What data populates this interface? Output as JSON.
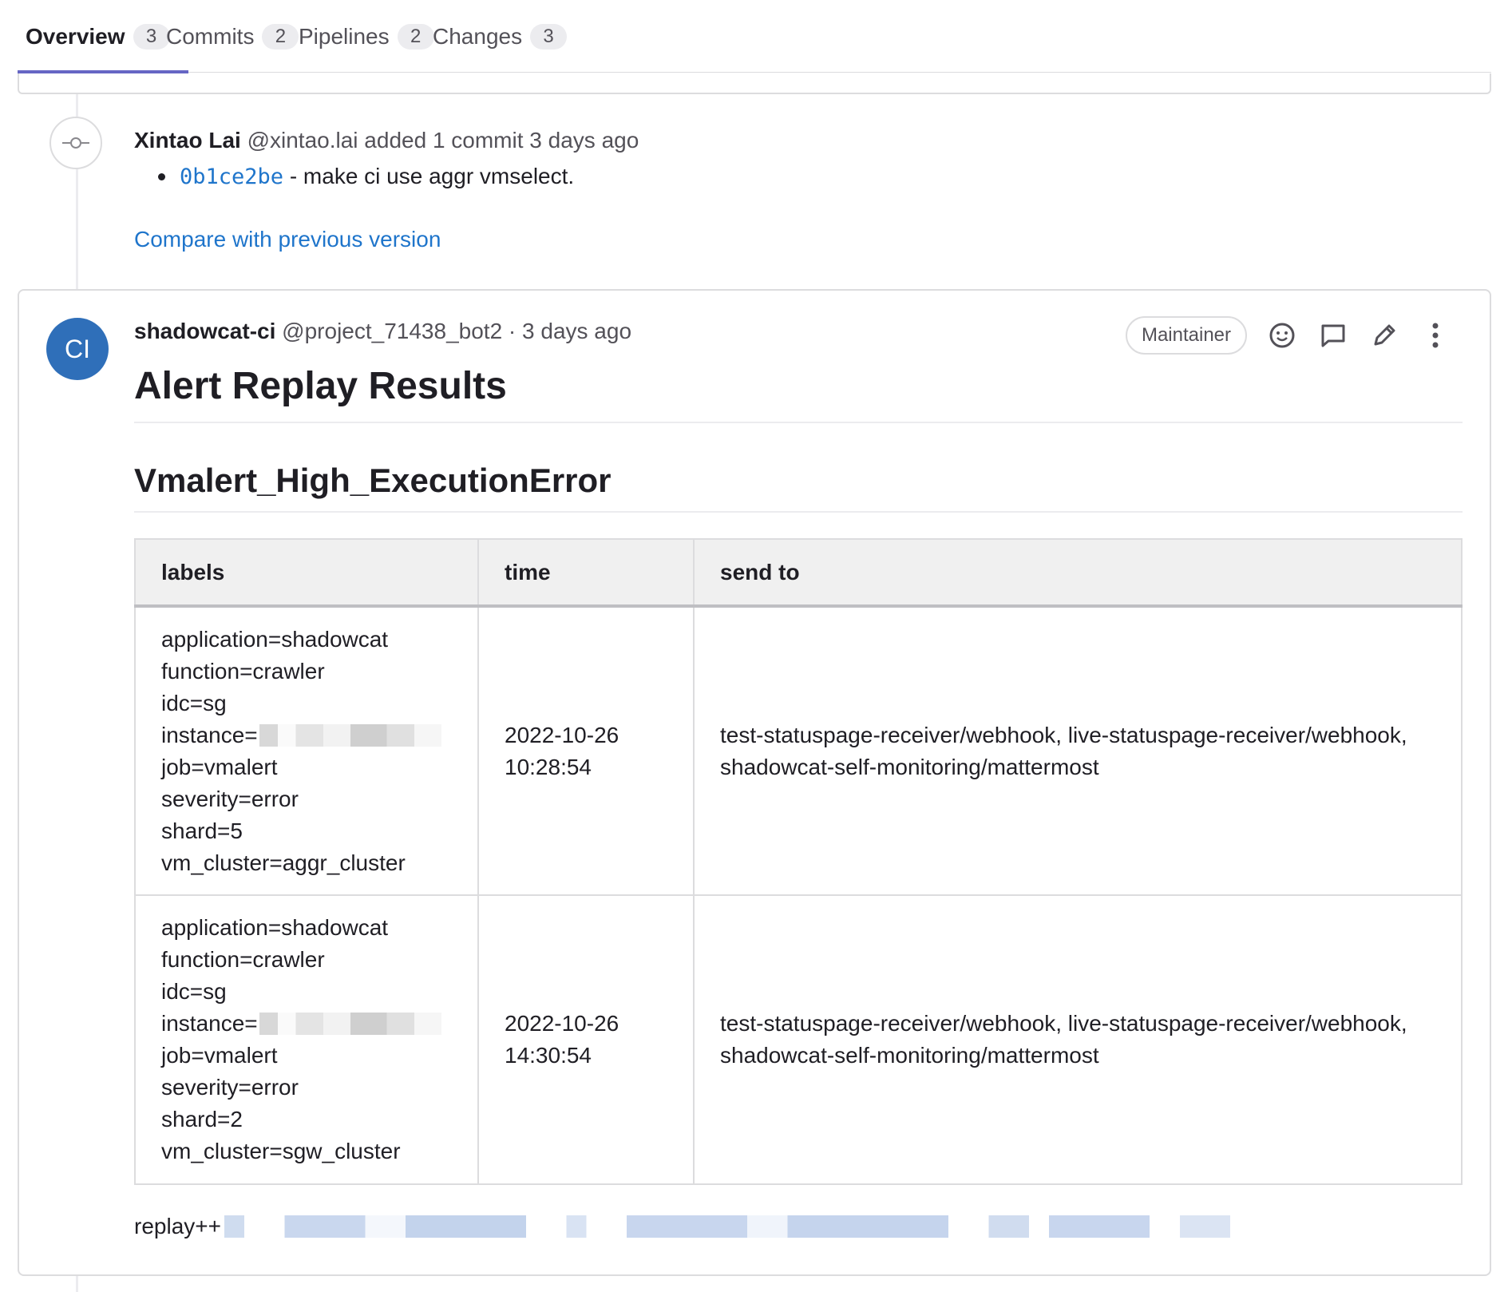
{
  "tabs": [
    {
      "label": "Overview",
      "count": "3"
    },
    {
      "label": "Commits",
      "count": "2"
    },
    {
      "label": "Pipelines",
      "count": "2"
    },
    {
      "label": "Changes",
      "count": "3"
    }
  ],
  "system_note": {
    "author": "Xintao Lai",
    "username": "@xintao.lai",
    "action": "added 1 commit 3 days ago",
    "commit_sha": "0b1ce2be",
    "commit_message": " - make ci use aggr vmselect.",
    "compare_link": "Compare with previous version"
  },
  "comment": {
    "avatar_initials": "CI",
    "author": "shadowcat-ci",
    "username": "@project_71438_bot2",
    "separator": " · ",
    "time": "3 days ago",
    "role": "Maintainer",
    "icons": [
      "smiley-icon",
      "comment-icon",
      "pencil-icon",
      "more-vertical-icon"
    ],
    "title": "Alert Replay Results",
    "alert_name": "Vmalert_High_ExecutionError",
    "table": {
      "headers": [
        "labels",
        "time",
        "send to"
      ],
      "rows": [
        {
          "labels": [
            "application=shadowcat",
            "function=crawler",
            "idc=sg",
            "instance=",
            "job=vmalert",
            "severity=error",
            "shard=5",
            "vm_cluster=aggr_cluster"
          ],
          "time": "2022-10-26 10:28:54",
          "send_to": "test-statuspage-receiver/webhook, live-statuspage-receiver/webhook, shadowcat-self-monitoring/mattermost"
        },
        {
          "labels": [
            "application=shadowcat",
            "function=crawler",
            "idc=sg",
            "instance=",
            "job=vmalert",
            "severity=error",
            "shard=2",
            "vm_cluster=sgw_cluster"
          ],
          "time": "2022-10-26 14:30:54",
          "send_to": "test-statuspage-receiver/webhook, live-statuspage-receiver/webhook, shadowcat-self-monitoring/mattermost"
        }
      ]
    },
    "footer_prefix": "replay++"
  },
  "colors": {
    "link": "#1f75cb",
    "active_tab": "#6666c4",
    "avatar": "#2f6fb9"
  }
}
